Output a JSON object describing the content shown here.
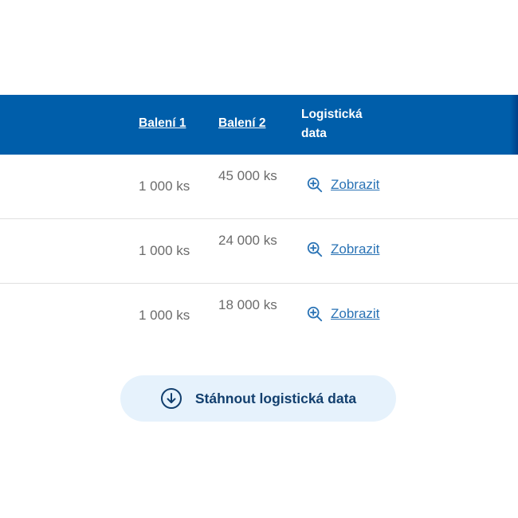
{
  "table": {
    "headers": {
      "col1": "Balení 1",
      "col2": "Balení 2",
      "col3": "Logistická data"
    },
    "rows": [
      {
        "pack1": "1 000 ks",
        "pack2": "45 000 ks",
        "action": "Zobrazit"
      },
      {
        "pack1": "1 000 ks",
        "pack2": "24 000 ks",
        "action": "Zobrazit"
      },
      {
        "pack1": "1 000 ks",
        "pack2": "18 000 ks",
        "action": "Zobrazit"
      }
    ]
  },
  "download": {
    "label": "Stáhnout logistická data",
    "icon": "download-arrow-icon"
  },
  "colors": {
    "header_bg": "#005eaa",
    "link": "#2a73b5",
    "button_bg": "#e6f2fc",
    "button_text": "#123f6e"
  }
}
